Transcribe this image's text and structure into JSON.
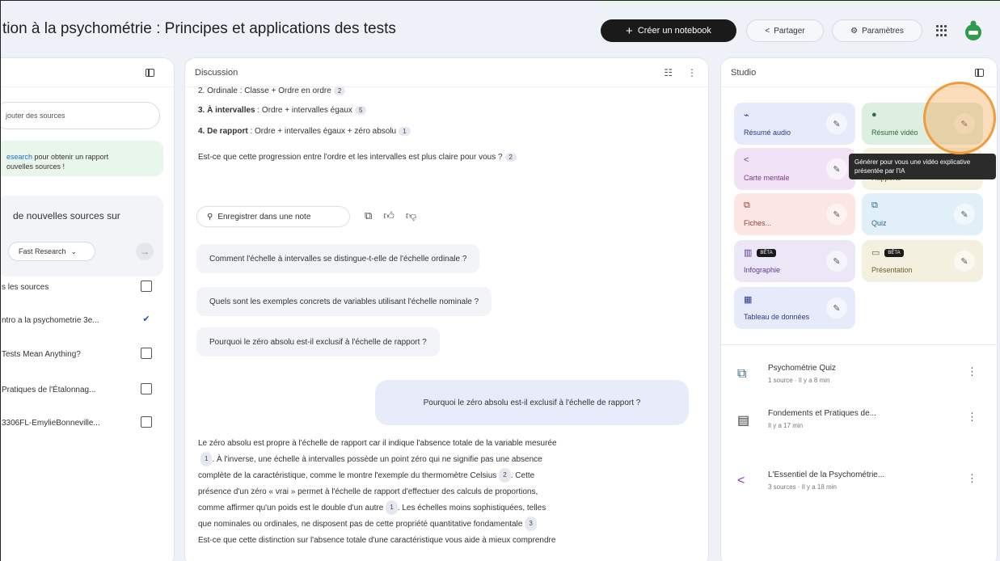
{
  "header": {
    "title": "tion à la psychométrie : Principes et applications des tests",
    "create_label": "Créer un notebook",
    "share_label": "Partager",
    "settings_label": "Paramètres"
  },
  "sources": {
    "search_placeholder": "jouter des sources",
    "banner_link": "esearch",
    "banner_text": " pour obtenir un rapport",
    "banner_text2": "ouvelles sources !",
    "discover_text": "de nouvelles sources sur",
    "fast_label": "Fast Research",
    "select_all": "s les sources",
    "items": [
      {
        "label": "ntro a la psychometrie 3e...",
        "checked": true
      },
      {
        "label": "Tests Mean Anything?",
        "checked": false
      },
      {
        "label": "Pratiques de l'Étalonnag...",
        "checked": false
      },
      {
        "label": "3306FL-EmylieBonneville...",
        "checked": false
      }
    ]
  },
  "discussion": {
    "title": "Discussion",
    "line_ordinal": "2. Ordinale : Classe + Ordre en ordre",
    "cite_ordinal": "2",
    "line_intervalles_bold": "3. À intervalles",
    "line_intervalles": " : Ordre + intervalles égaux",
    "cite_intervalles": "5",
    "line_rapport_bold": "4. De rapport",
    "line_rapport": " : Ordre + intervalles égaux + zéro absolu",
    "cite_rapport": "1",
    "question": "Est-ce que cette progression entre l'ordre et les intervalles est plus claire pour vous ?",
    "cite_question": "2",
    "save_note": "Enregistrer dans une note",
    "suggestions": [
      "Comment l'échelle à intervalles se distingue-t-elle de l'échelle ordinale ?",
      "Quels sont les exemples concrets de variables utilisant l'échelle nominale ?",
      "Pourquoi le zéro absolu est-il exclusif à l'échelle de rapport ?"
    ],
    "user_message": "Pourquoi le zéro absolu est-il exclusif à l'échelle de rapport ?",
    "answer": {
      "l1": "Le zéro absolu est propre à l'échelle de rapport car il indique l'absence totale de la variable mesurée",
      "c1": "1",
      "l2": ". À l'inverse, une échelle à intervalles possède un point zéro qui ne signifie pas une absence",
      "l3": "complète de la caractéristique, comme le montre l'exemple du thermomètre Celsius",
      "c3": "2",
      "l3b": ". Cette",
      "l4": "présence d'un zéro « vrai » permet à l'échelle de rapport d'effectuer des calculs de proportions,",
      "l5": "comme affirmer qu'un poids est le double d'un autre",
      "c5": "1",
      "l5b": ". Les échelles moins sophistiquées, telles",
      "l6": "que nominales ou ordinales, ne disposent pas de cette propriété quantitative fondamentale",
      "c6": "3",
      "l7": "Est-ce que cette distinction sur l'absence totale d'une caractéristique vous aide à mieux comprendre"
    }
  },
  "studio": {
    "title": "Studio",
    "tiles": {
      "audio": "Résumé audio",
      "video": "Résumé vidéo",
      "mindmap": "Carte mentale",
      "report": "Rapports",
      "flashcards": "Fiches...",
      "quiz": "Quiz",
      "infographic": "Infographie",
      "presentation": "Présentation",
      "table": "Tableau de données"
    },
    "beta": "BÊTA",
    "tooltip": "Générer pour vous une vidéo explicative présentée par l'IA",
    "notes": [
      {
        "title": "Psychométrie Quiz",
        "sub": "1 source · Il y a 8 min"
      },
      {
        "title": "Fondements et Pratiques de...",
        "sub": "Il y a 17 min"
      },
      {
        "title": "L'Essentiel de la Psychométrie...",
        "sub": "3 sources · Il y a 18 min"
      }
    ]
  }
}
